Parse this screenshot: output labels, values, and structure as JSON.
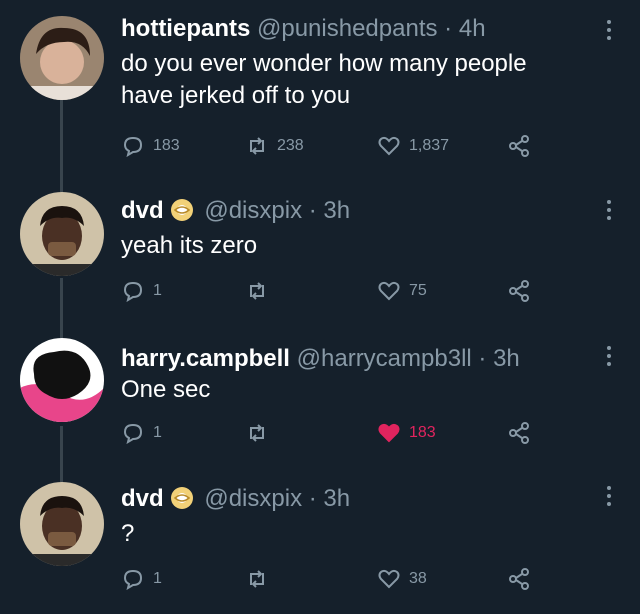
{
  "tweets": [
    {
      "name": "hottiepants",
      "handle": "@punishedpants",
      "sep": "·",
      "time": "4h",
      "text_lines": [
        "do you ever wonder how many people",
        "have jerked off to you"
      ],
      "replies": "183",
      "retweets": "238",
      "likes": "1,837",
      "verified": false,
      "liked": false
    },
    {
      "name": "dvd",
      "handle": "@disxpix",
      "sep": "·",
      "time": "3h",
      "text_lines": [
        "yeah its zero"
      ],
      "replies": "1",
      "retweets": "",
      "likes": "75",
      "verified": true,
      "liked": false
    },
    {
      "name": "harry.campbell",
      "handle": "@harrycampb3ll",
      "sep": "·",
      "time": "3h",
      "text_lines": [
        "One sec"
      ],
      "replies": "1",
      "retweets": "",
      "likes": "183",
      "verified": false,
      "liked": true
    },
    {
      "name": "dvd",
      "handle": "@disxpix",
      "sep": "·",
      "time": "3h",
      "text_lines": [
        "?"
      ],
      "replies": "1",
      "retweets": "",
      "likes": "38",
      "verified": true,
      "liked": false
    }
  ],
  "icons": {
    "reply": "reply-icon",
    "retweet": "retweet-icon",
    "like": "heart-icon",
    "share": "share-icon",
    "more": "more-options-icon",
    "badge": "gold-badge-icon"
  },
  "colors": {
    "background": "#15202b",
    "secondary_text": "#8899a6",
    "like_active": "#e0245e",
    "thread_line": "#38444d"
  }
}
